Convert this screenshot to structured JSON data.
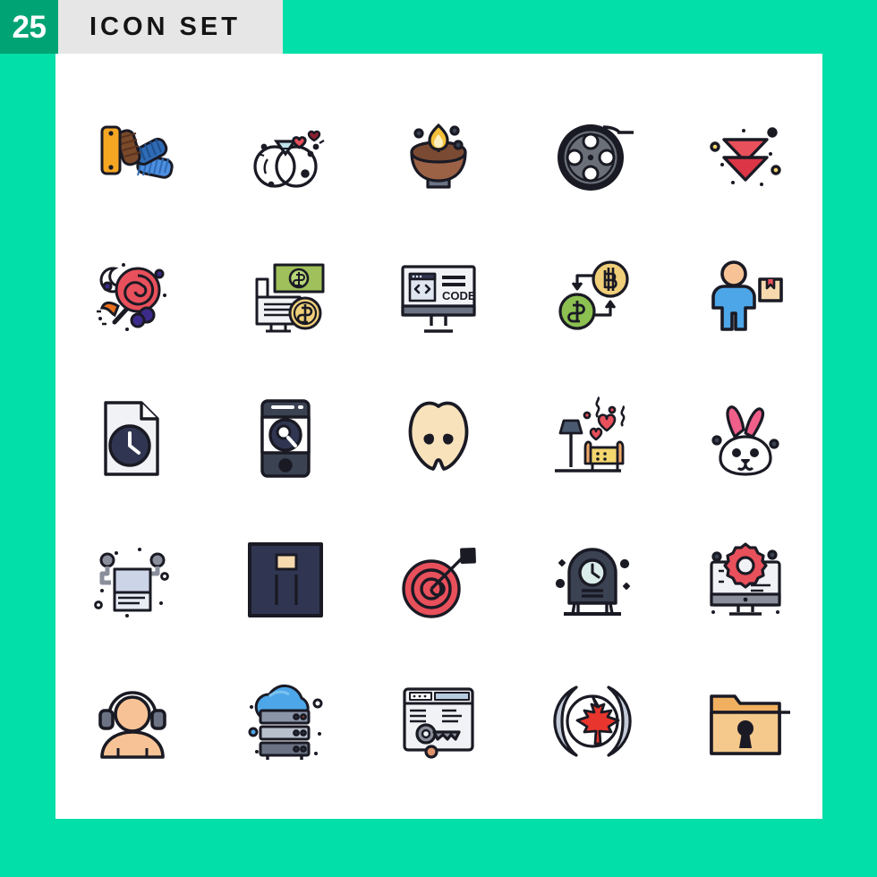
{
  "header": {
    "badge_count": "25",
    "title": "ICON SET"
  },
  "colors": {
    "background_green": "#03dfa8",
    "badge_green": "#00a474",
    "title_bar_gray": "#e6e6e6",
    "card_white": "#ffffff",
    "outline_dark": "#1a1a24",
    "accent_red": "#e8505b",
    "accent_orange": "#f5a623",
    "accent_blue": "#4da6e8",
    "accent_green": "#8cc152",
    "accent_yellow": "#f7d070",
    "accent_pink": "#ef5f8a",
    "accent_skin": "#f7c396",
    "accent_navy": "#303651",
    "accent_gray": "#8b8f9b"
  },
  "grid": {
    "rows": 5,
    "columns": 5,
    "total_icons": 25
  },
  "icons": [
    {
      "id": 1,
      "name": "color-palette-icon",
      "label": "Color Palette"
    },
    {
      "id": 2,
      "name": "wedding-rings-icon",
      "label": "Wedding Rings"
    },
    {
      "id": 3,
      "name": "diya-lamp-icon",
      "label": "Diya Oil Lamp"
    },
    {
      "id": 4,
      "name": "film-reel-icon",
      "label": "Film Reel"
    },
    {
      "id": 5,
      "name": "double-down-arrow-icon",
      "label": "Double Down Arrow"
    },
    {
      "id": 6,
      "name": "lollipop-candy-icon",
      "label": "Lollipop Candy"
    },
    {
      "id": 7,
      "name": "online-banking-icon",
      "label": "Online Banking"
    },
    {
      "id": 8,
      "name": "code-monitor-icon",
      "label": "Code Monitor",
      "screen_text": "CODE"
    },
    {
      "id": 9,
      "name": "bitcoin-exchange-icon",
      "label": "Bitcoin Dollar Exchange"
    },
    {
      "id": 10,
      "name": "delivery-person-icon",
      "label": "Delivery Person"
    },
    {
      "id": 11,
      "name": "file-clock-icon",
      "label": "File History"
    },
    {
      "id": 12,
      "name": "mobile-search-icon",
      "label": "Mobile Search"
    },
    {
      "id": 13,
      "name": "apple-slice-icon",
      "label": "Apple Slice"
    },
    {
      "id": 14,
      "name": "romantic-room-icon",
      "label": "Romantic Living Room"
    },
    {
      "id": 15,
      "name": "bunny-face-icon",
      "label": "Bunny Face"
    },
    {
      "id": 16,
      "name": "towel-rack-icon",
      "label": "Towel Rack"
    },
    {
      "id": 17,
      "name": "weight-scale-icon",
      "label": "Weighing Scale"
    },
    {
      "id": 18,
      "name": "target-dart-icon",
      "label": "Target With Dart"
    },
    {
      "id": 19,
      "name": "mantel-clock-icon",
      "label": "Mantel Clock"
    },
    {
      "id": 20,
      "name": "monitor-settings-icon",
      "label": "Monitor Settings"
    },
    {
      "id": 21,
      "name": "support-agent-icon",
      "label": "Support Agent"
    },
    {
      "id": 22,
      "name": "cloud-server-icon",
      "label": "Cloud Server"
    },
    {
      "id": 23,
      "name": "key-webpage-icon",
      "label": "Webpage Key Access"
    },
    {
      "id": 24,
      "name": "maple-leaf-shield-icon",
      "label": "Maple Leaf Emblem"
    },
    {
      "id": 25,
      "name": "locked-folder-icon",
      "label": "Locked Folder"
    }
  ]
}
